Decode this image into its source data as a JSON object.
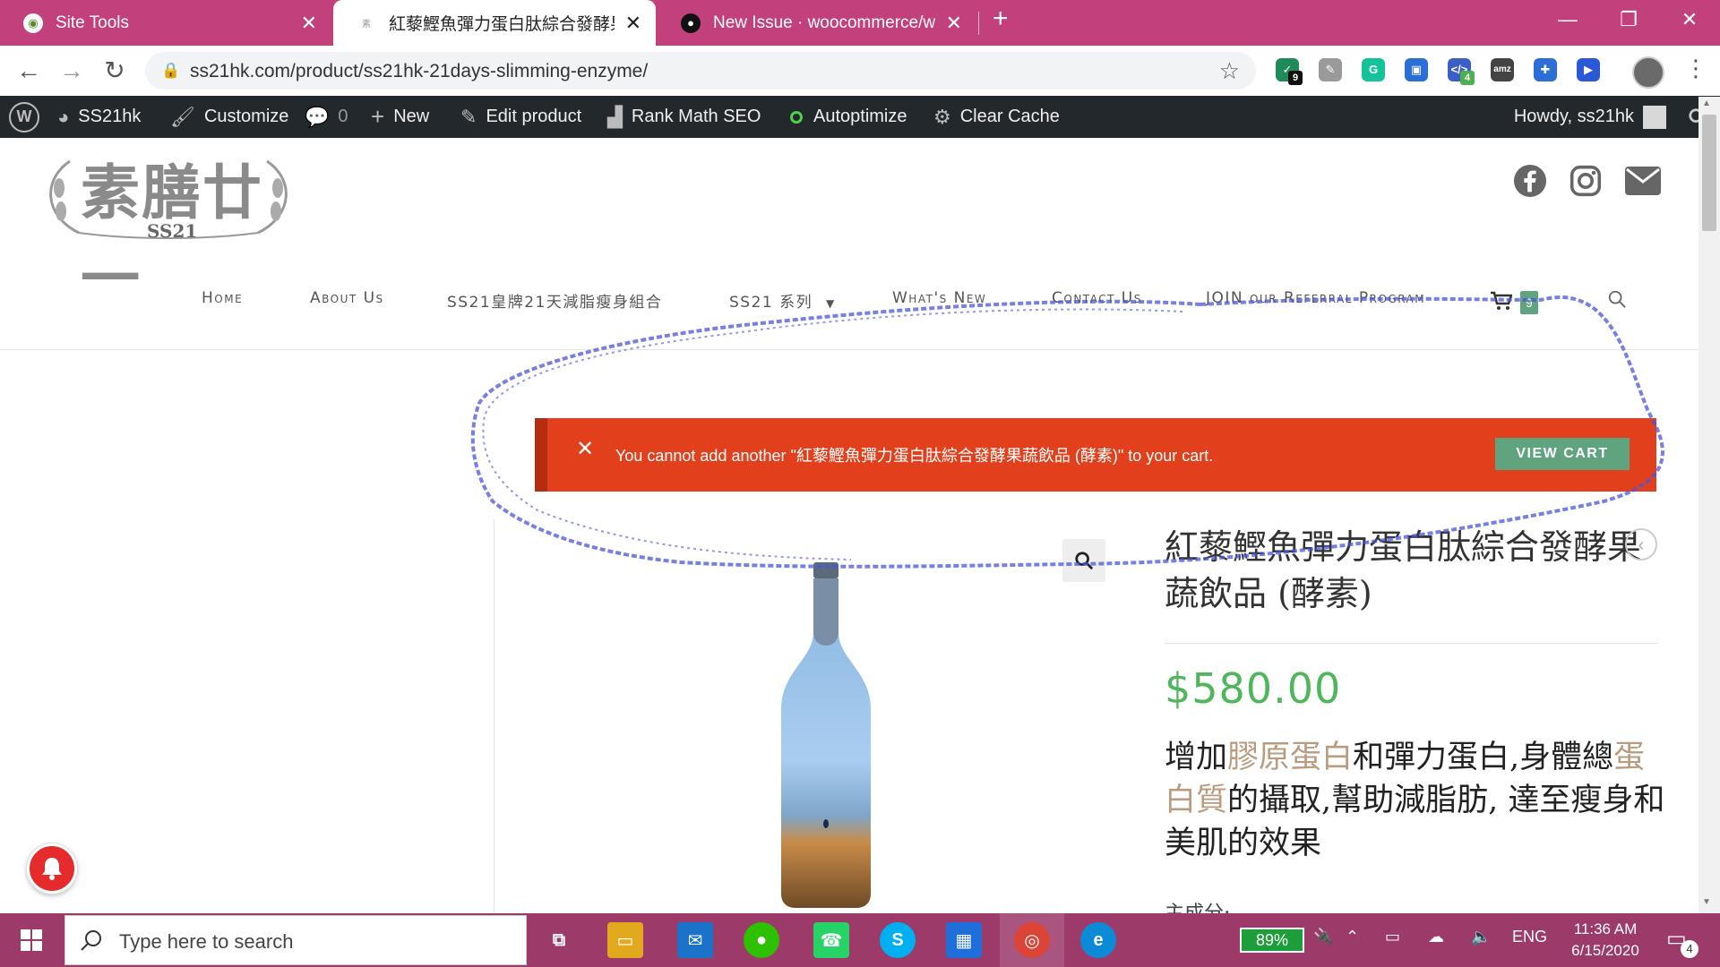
{
  "browser": {
    "tabs": [
      {
        "title": "Site Tools",
        "active": false
      },
      {
        "title": "紅藜鰹魚彈力蛋白肽綜合發酵果蔬飲品 (酵素)",
        "active": true
      },
      {
        "title": "New Issue · woocommerce/woocommerce",
        "active": false
      }
    ],
    "url": "ss21hk.com/product/ss21hk-21days-slimming-enzyme/",
    "extensions": [
      {
        "name": "shield-extension",
        "badge": "9",
        "color": "#1f8a5a"
      },
      {
        "name": "notes-extension",
        "badge": "",
        "color": "#9a9a9a"
      },
      {
        "name": "grammarly-extension",
        "badge": "",
        "color": "#15c39a"
      },
      {
        "name": "translate-extension",
        "badge": "",
        "color": "#2b6fd6"
      },
      {
        "name": "code-extension",
        "badge": "4",
        "color": "#3b5fc4"
      },
      {
        "name": "amz-extension",
        "badge": "",
        "color": "#444444"
      },
      {
        "name": "plus-extension",
        "badge": "",
        "color": "#2b6fd6"
      },
      {
        "name": "arrow-extension",
        "badge": "",
        "color": "#2b58d6"
      }
    ]
  },
  "adminbar": {
    "site": "SS21hk",
    "customize": "Customize",
    "comments": "0",
    "new": "New",
    "edit": "Edit product",
    "rankmath": "Rank Math SEO",
    "autoptimize": "Autoptimize",
    "clearcache": "Clear Cache",
    "howdy": "Howdy, ss21hk"
  },
  "logo": {
    "text": "素膳廿一",
    "sub": "SS21"
  },
  "menu": {
    "home": "Home",
    "about": "About Us",
    "combo": "SS21皇牌21天減脂瘦身組合",
    "series": "SS21 系列",
    "whatsnew": "What's New",
    "contact": "Contact Us",
    "referral": "JOIN our Referral Program",
    "cart_count": "9"
  },
  "notice": {
    "message": "You cannot add another \"紅藜鰹魚彈力蛋白肽綜合發酵果蔬飲品 (酵素)\" to your cart.",
    "button": "VIEW CART"
  },
  "product": {
    "title": "紅藜鰹魚彈力蛋白肽綜合發酵果蔬飲品 (酵素)",
    "price": "$580.00",
    "desc": {
      "p1": "增加",
      "h1": "膠原蛋白",
      "p2": "和彈力蛋白,身體總",
      "h2": "蛋白質",
      "p3": "的攝取,幫助減脂肪, 達至瘦身和美肌的效果"
    },
    "ingredients_label": "主成分:"
  },
  "taskbar": {
    "search_placeholder": "Type here to search",
    "battery": "89%",
    "language": "ENG",
    "time": "11:36 AM",
    "date": "6/15/2020",
    "notifications": "4"
  },
  "colors": {
    "tab_bar": "#c2407c",
    "notice_bg": "#e2401c",
    "view_cart_bg": "#5fa37f",
    "price": "#4fb65c",
    "admin_bar": "#23282d",
    "taskbar": "#9c3a6a"
  }
}
